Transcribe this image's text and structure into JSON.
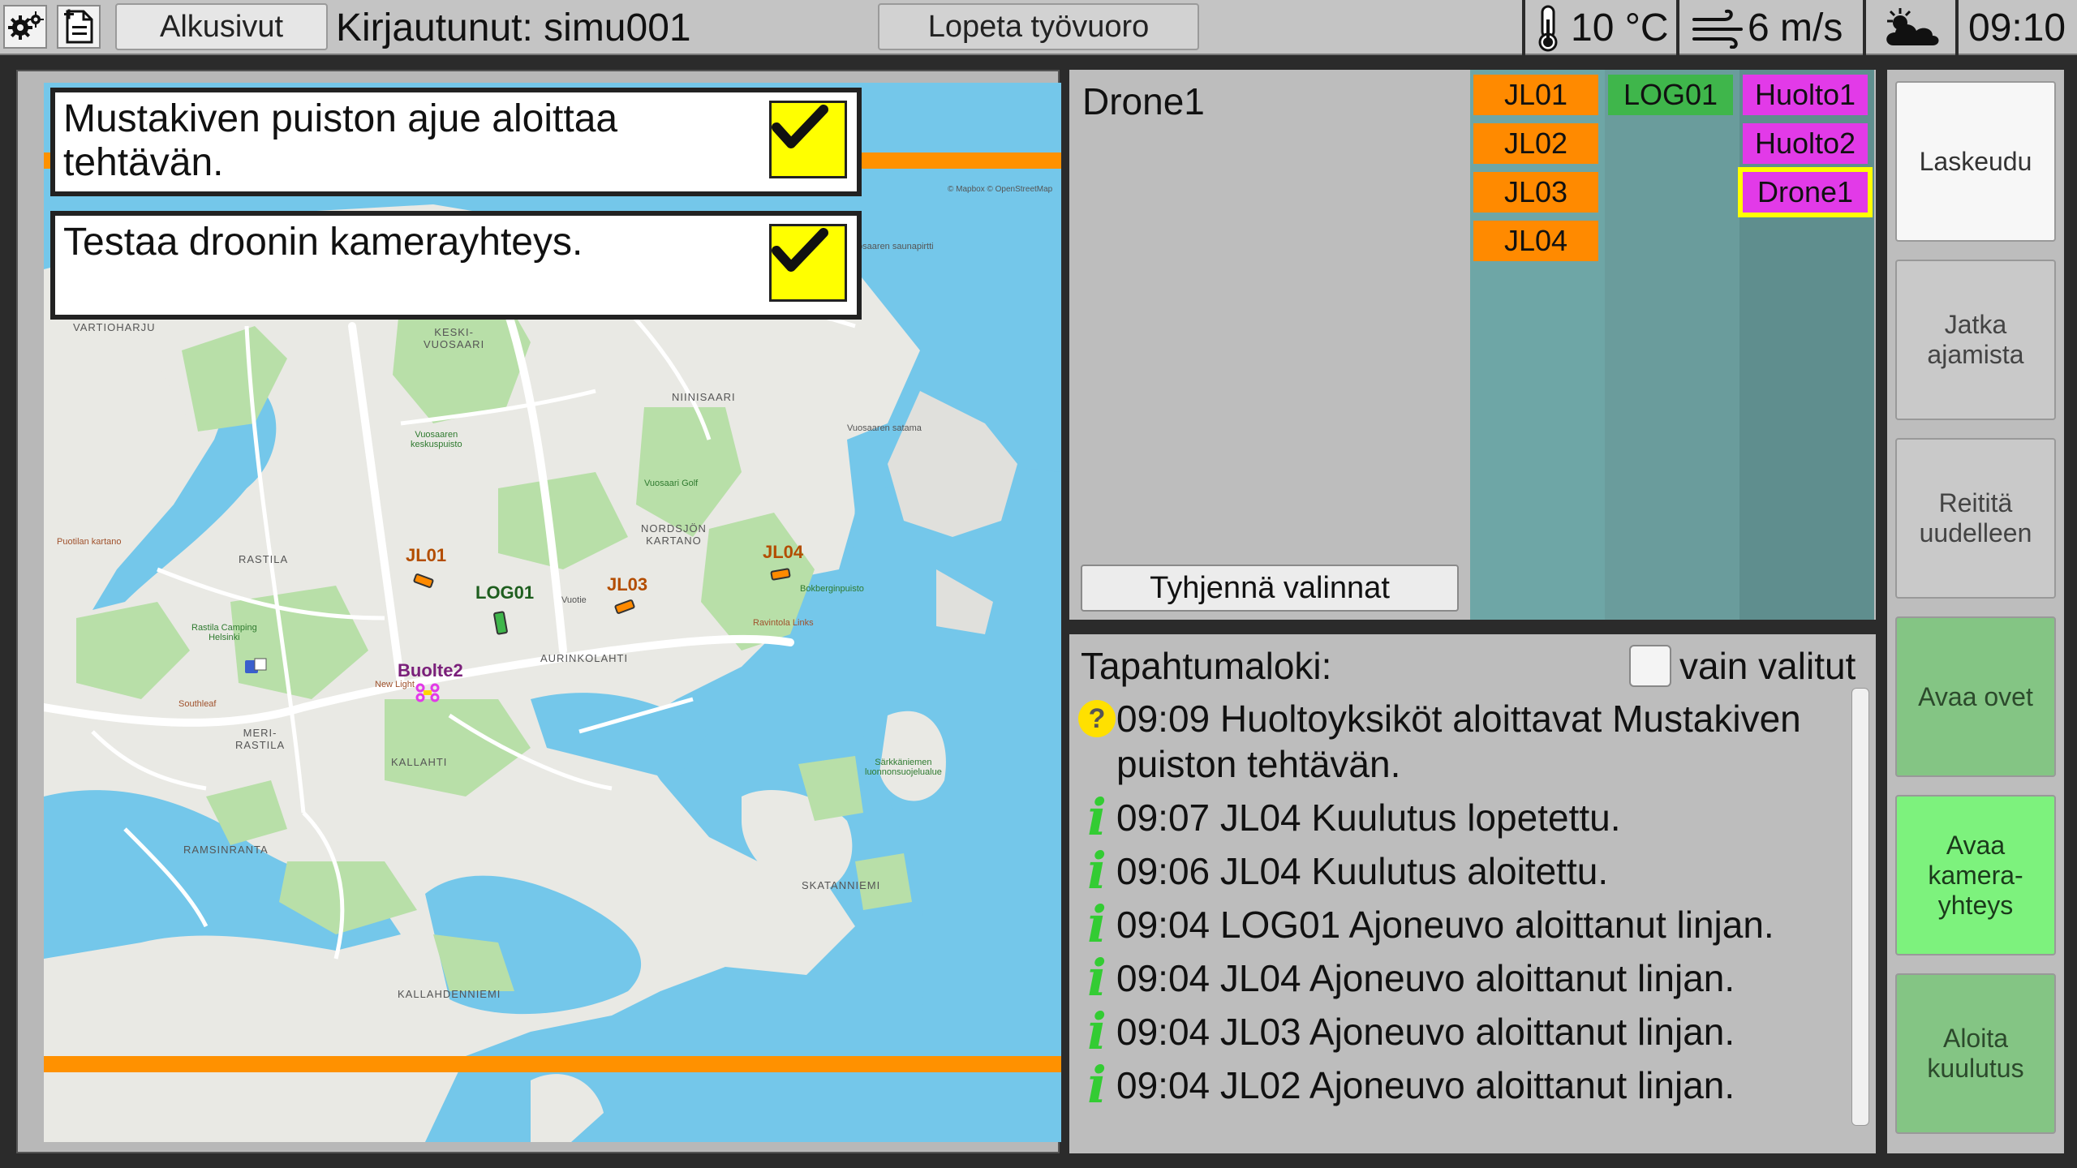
{
  "topbar": {
    "home_label": "Alkusivut",
    "logged_in": "Kirjautunut: simu001",
    "end_shift_label": "Lopeta työvuoro",
    "temperature": "10 °C",
    "wind": "6 m/s",
    "weather_icon": "partly-cloudy-icon",
    "time": "09:10"
  },
  "tasks": [
    {
      "text": "Mustakiven puiston ajue aloittaa tehtävän."
    },
    {
      "text": "Testaa droonin kamerayhteys."
    }
  ],
  "map": {
    "vehicles": [
      {
        "id": "JL01",
        "color": "#ff8a00"
      },
      {
        "id": "LOG01",
        "color": "#3fb64b"
      },
      {
        "id": "JL03",
        "color": "#ff8a00"
      },
      {
        "id": "JL04",
        "color": "#ff8a00"
      },
      {
        "id": "Huolto1/Huolto2",
        "label": "Buolte2",
        "color": "#e23ae8"
      }
    ],
    "labels": {
      "vartioharju": "VARTIOHARJU",
      "keski_vuosaari": "KESKI-\nVUOSAARI",
      "niinisaari": "NIINISAARI",
      "vuosaaren_keskuspuisto": "Vuosaaren\nkeskuspuisto",
      "rastila": "RASTILA",
      "nordsjon_kartano": "NORDSJÖN\nKARTANO",
      "aurinkolahti": "AURINKOLAHTI",
      "meri_rastila": "MERI-\nRASTILA",
      "kallahti": "KALLAHTI",
      "ramsinranta": "RAMSINRANTA",
      "kallahdenniemi": "KALLAHDENNIEMI",
      "skatanniemi": "SKATANNIEMI",
      "vuotie": "Vuotie",
      "vuosaaren_satama": "Vuosaaren satama",
      "vuosaari_golf": "Vuosaari Golf",
      "rastila_camping": "Rastila Camping\nHelsinki",
      "puotilan_kartano": "Puotilan kartano",
      "sarkkaniemen": "Särkkäniemen\nluonnonsuojelualue",
      "copyright": "© Mapbox © OpenStreetMap",
      "vuosaaren_saunapirtti": "Vuosaaren saunapirtti",
      "ravintola_links": "Ravintola Links",
      "bokberginpuisto": "Bokberginpuisto",
      "southleaf": "Southleaf",
      "new_light": "New Light"
    }
  },
  "selection": {
    "selected_name": "Drone1",
    "clear_label": "Tyhjennä valinnat",
    "columns": [
      [
        {
          "id": "JL01",
          "kind": "orange"
        },
        {
          "id": "JL02",
          "kind": "orange"
        },
        {
          "id": "JL03",
          "kind": "orange"
        },
        {
          "id": "JL04",
          "kind": "orange"
        }
      ],
      [
        {
          "id": "LOG01",
          "kind": "green"
        }
      ],
      [
        {
          "id": "Huolto1",
          "kind": "magenta"
        },
        {
          "id": "Huolto2",
          "kind": "magenta"
        },
        {
          "id": "Drone1",
          "kind": "magenta",
          "selected": true
        }
      ]
    ]
  },
  "log": {
    "title": "Tapahtumaloki:",
    "only_selected_label": "vain valitut",
    "entries": [
      {
        "type": "question",
        "text": "09:09 Huoltoyksiköt aloittavat Mustakiven puiston tehtävän."
      },
      {
        "type": "info",
        "text": "09:07 JL04 Kuulutus lopetettu."
      },
      {
        "type": "info",
        "text": "09:06 JL04 Kuulutus aloitettu."
      },
      {
        "type": "info",
        "text": "09:04 LOG01 Ajoneuvo aloittanut linjan."
      },
      {
        "type": "info",
        "text": "09:04 JL04 Ajoneuvo aloittanut linjan."
      },
      {
        "type": "info",
        "text": "09:04 JL03 Ajoneuvo aloittanut linjan."
      },
      {
        "type": "info",
        "text": "09:04 JL02 Ajoneuvo aloittanut linjan."
      }
    ]
  },
  "side_buttons": {
    "land": "Laskeudu",
    "continue": "Jatka ajamista",
    "reroute": "Reititä uudelleen",
    "open_doors": "Avaa ovet",
    "open_camera": "Avaa kamera-yhteys",
    "start_announcement": "Aloita kuulutus"
  },
  "colors": {
    "orange": "#ff8a00",
    "green": "#3fb64b",
    "magenta": "#e23ae8",
    "water": "#74c7ea",
    "highlight": "#ffff00"
  }
}
